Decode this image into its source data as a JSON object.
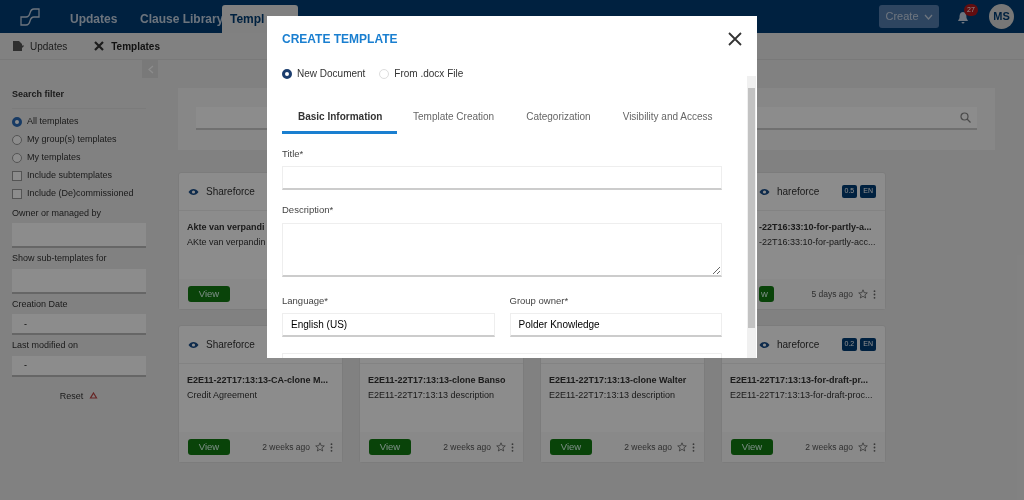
{
  "topnav": {
    "tabs": [
      {
        "label": "Updates",
        "selected": false
      },
      {
        "label": "Clause Library",
        "selected": false
      },
      {
        "label": "Templ",
        "selected": true
      }
    ],
    "create_button": "Create",
    "notification_count": "27",
    "avatar": "MS"
  },
  "subnav": [
    "Updates",
    "Templates"
  ],
  "sidebar": {
    "title": "Search filter",
    "options": [
      {
        "kind": "radio",
        "label": "All templates",
        "checked": true
      },
      {
        "kind": "radio",
        "label": "My group(s) templates",
        "checked": false
      },
      {
        "kind": "radio",
        "label": "My templates",
        "checked": false
      },
      {
        "kind": "checkbox",
        "label": "Include subtemplates",
        "checked": false
      },
      {
        "kind": "checkbox",
        "label": "Include (De)commissioned",
        "checked": false
      }
    ],
    "fields": [
      {
        "label": "Owner or managed by"
      },
      {
        "label": "Show sub-templates for"
      },
      {
        "label": "Creation Date",
        "value": "-"
      },
      {
        "label": "Last modified on",
        "value": "-"
      }
    ],
    "reset": "Reset"
  },
  "cards": [
    {
      "header": "Shareforce",
      "title": "Akte van verpandi",
      "description": "AKte van verpandin",
      "button": "View"
    },
    {
      "header": "hareforce",
      "badges": [
        "0.5",
        "EN"
      ],
      "title": "-22T16:33:10-for-partly-a...",
      "description": "-22T16:33:10-for-partly-acc...",
      "button": "w",
      "time": "5 days ago"
    },
    {
      "header": "Shareforce",
      "title": "E2E11-22T17:13:13-CA-clone M...",
      "description": "Credit Agreement",
      "button": "View",
      "time": "2 weeks ago"
    },
    {
      "title": "E2E11-22T17:13:13-clone Banso",
      "description": "E2E11-22T17:13:13 description",
      "button": "View",
      "time": "2 weeks ago"
    },
    {
      "title": "E2E11-22T17:13:13-clone Walter",
      "description": "E2E11-22T17:13:13 description",
      "button": "View",
      "time": "2 weeks ago"
    },
    {
      "header": "hareforce",
      "badges": [
        "0.2",
        "EN"
      ],
      "title": "E2E11-22T17:13:13-for-draft-pr...",
      "description": "E2E11-22T17:13:13-for-draft-proc...",
      "button": "View",
      "time": "2 weeks ago"
    }
  ],
  "modal": {
    "title": "CREATE TEMPLATE",
    "sources": [
      {
        "label": "New Document",
        "selected": true
      },
      {
        "label": "From .docx File",
        "selected": false
      }
    ],
    "tabs": [
      {
        "label": "Basic Information",
        "selected": true
      },
      {
        "label": "Template Creation",
        "selected": false
      },
      {
        "label": "Categorization",
        "selected": false
      },
      {
        "label": "Visibility and Access",
        "selected": false
      }
    ],
    "title_label": "Title*",
    "description_label": "Description*",
    "language": {
      "label": "Language*",
      "value": "English (US)"
    },
    "group_owner": {
      "label": "Group owner*",
      "value": "Polder Knowledge"
    }
  }
}
